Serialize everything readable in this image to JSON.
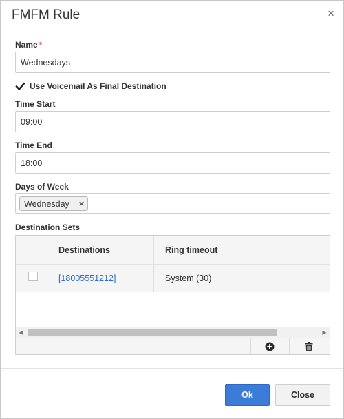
{
  "dialog": {
    "title": "FMFM Rule",
    "close_glyph": "×"
  },
  "form": {
    "name_label": "Name",
    "required_marker": "*",
    "name_value": "Wednesdays",
    "voicemail_checkbox_label": "Use Voicemail As Final Destination",
    "voicemail_checked": true,
    "time_start_label": "Time Start",
    "time_start_value": "09:00",
    "time_end_label": "Time End",
    "time_end_value": "18:00",
    "days_label": "Days of Week",
    "days_selected": [
      "Wednesday"
    ],
    "tag_remove_glyph": "×"
  },
  "destination_sets": {
    "label": "Destination Sets",
    "columns": [
      "Destinations",
      "Ring timeout"
    ],
    "rows": [
      {
        "selected": false,
        "destination": "[18005551212]",
        "ring_timeout": "System (30)"
      }
    ],
    "scroll_left_glyph": "◀",
    "scroll_right_glyph": "▶",
    "toolbar": {
      "add_icon": "plus-circle",
      "delete_icon": "trash"
    }
  },
  "footer": {
    "ok_label": "Ok",
    "close_label": "Close"
  },
  "colors": {
    "primary": "#3c7cd9",
    "link": "#2a6fc9",
    "required": "#d9534f"
  }
}
